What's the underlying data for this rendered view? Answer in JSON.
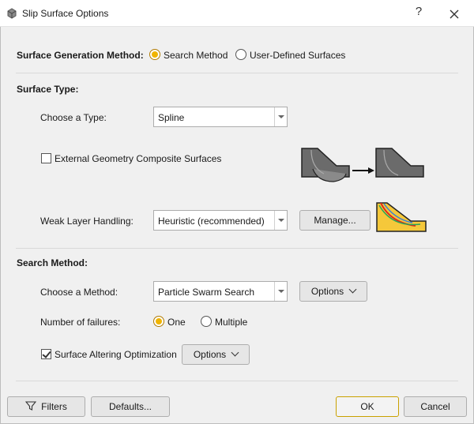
{
  "window": {
    "title": "Slip Surface Options",
    "help": "?"
  },
  "generation": {
    "label": "Surface Generation Method:",
    "options": [
      {
        "label": "Search Method",
        "selected": true
      },
      {
        "label": "User-Defined Surfaces",
        "selected": false
      }
    ]
  },
  "surface_type": {
    "heading": "Surface Type:",
    "choose_label": "Choose a Type:",
    "choose_value": "Spline",
    "external_label": "External Geometry Composite Surfaces",
    "external_checked": false,
    "weak_label": "Weak Layer Handling:",
    "weak_value": "Heuristic (recommended)",
    "manage_label": "Manage..."
  },
  "search_method": {
    "heading": "Search Method:",
    "choose_label": "Choose a Method:",
    "choose_value": "Particle Swarm Search",
    "options_label": "Options",
    "failures_label": "Number of failures:",
    "failures_options": [
      {
        "label": "One",
        "selected": true
      },
      {
        "label": "Multiple",
        "selected": false
      }
    ],
    "altering_label": "Surface Altering Optimization",
    "altering_checked": true,
    "altering_options_label": "Options"
  },
  "footer": {
    "filters_label": "Filters",
    "defaults_label": "Defaults...",
    "ok_label": "OK",
    "cancel_label": "Cancel"
  },
  "icons": {
    "app": "slide-app-icon",
    "close": "close-icon",
    "funnel": "funnel-icon",
    "chevron": "chevron-down-icon"
  },
  "colors": {
    "accent": "#f0b400",
    "ok_border": "#c9a100"
  }
}
